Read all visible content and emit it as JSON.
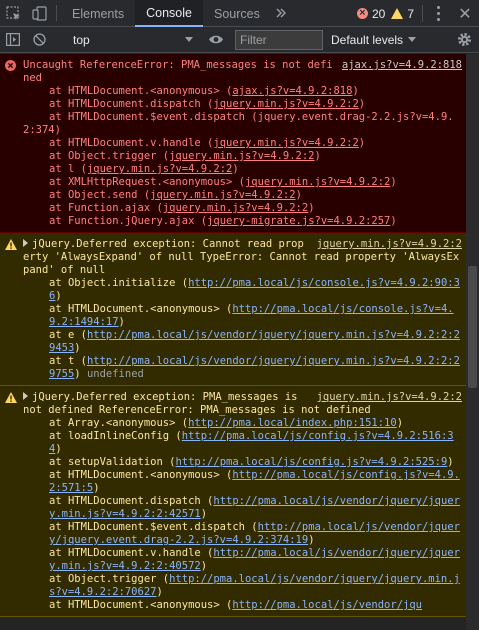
{
  "tabs": [
    {
      "label": "Elements"
    },
    {
      "label": "Console"
    },
    {
      "label": "Sources"
    }
  ],
  "counts": {
    "errors": "20",
    "warnings": "7"
  },
  "toolbar": {
    "context": "top",
    "filter_placeholder": "Filter",
    "levels": "Default levels"
  },
  "messages": [
    {
      "level": "error",
      "source": "ajax.js?v=4.9.2:818",
      "head": "Uncaught ReferenceError: PMA_messages is not defined",
      "stack": [
        {
          "pre": "at HTMLDocument.<anonymous> (",
          "link": "ajax.js?v=4.9.2:818",
          "post": ")"
        },
        {
          "pre": "at HTMLDocument.dispatch (",
          "link": "jquery.min.js?v=4.9.2:2",
          "post": ")"
        },
        {
          "pre": "at HTMLDocument.$event.dispatch (",
          "link": "jquery.event.drag-2.2.js?v=4.9.2:374",
          "post": ")"
        },
        {
          "pre": "at HTMLDocument.v.handle (",
          "link": "jquery.min.js?v=4.9.2:2",
          "post": ")"
        },
        {
          "pre": "at Object.trigger (",
          "link": "jquery.min.js?v=4.9.2:2",
          "post": ")"
        },
        {
          "pre": "at l (",
          "link": "jquery.min.js?v=4.9.2:2",
          "post": ")"
        },
        {
          "pre": "at XMLHttpRequest.<anonymous> (",
          "link": "jquery.min.js?v=4.9.2:2",
          "post": ")"
        },
        {
          "pre": "at Object.send (",
          "link": "jquery.min.js?v=4.9.2:2",
          "post": ")"
        },
        {
          "pre": "at Function.ajax (",
          "link": "jquery.min.js?v=4.9.2:2",
          "post": ")"
        },
        {
          "pre": "at Function.jQuery.ajax (",
          "link": "jquery-migrate.js?v=4.9.2:257",
          "post": ")"
        }
      ]
    },
    {
      "level": "warn",
      "source": "jquery.min.js?v=4.9.2:2",
      "head": "jQuery.Deferred exception: Cannot read property 'AlwaysExpand' of null TypeError: Cannot read property 'AlwaysExpand' of null",
      "stack": [
        {
          "pre": "at Object.initialize (",
          "link": "http://pma.local/js/console.js?v=4.9.2:90:36",
          "post": ")"
        },
        {
          "pre": "at HTMLDocument.<anonymous> (",
          "link": "http://pma.local/js/console.js?v=4.9.2:1494:17",
          "post": ")"
        },
        {
          "pre": "at e (",
          "link": "http://pma.local/js/vendor/jquery/jquery.min.js?v=4.9.2:2:29453",
          "post": ")"
        },
        {
          "pre": "at t (",
          "link": "http://pma.local/js/vendor/jquery/jquery.min.js?v=4.9.2:2:29755",
          "post": ")",
          "suffix": "undefined"
        }
      ]
    },
    {
      "level": "warn",
      "source": "jquery.min.js?v=4.9.2:2",
      "head": "jQuery.Deferred exception: PMA_messages is not defined ReferenceError: PMA_messages is not defined",
      "stack": [
        {
          "pre": "at Array.<anonymous> (",
          "link": "http://pma.local/index.php:151:10",
          "post": ")"
        },
        {
          "pre": "at loadInlineConfig (",
          "link": "http://pma.local/js/config.js?v=4.9.2:516:34",
          "post": ")"
        },
        {
          "pre": "at setupValidation (",
          "link": "http://pma.local/js/config.js?v=4.9.2:525:9",
          "post": ")"
        },
        {
          "pre": "at HTMLDocument.<anonymous> (",
          "link": "http://pma.local/js/config.js?v=4.9.2:571:5",
          "post": ")"
        },
        {
          "pre": "at HTMLDocument.dispatch (",
          "link": "http://pma.local/js/vendor/jquery/jquery.min.js?v=4.9.2:2:42571",
          "post": ")"
        },
        {
          "pre": "at HTMLDocument.$event.dispatch (",
          "link": "http://pma.local/js/vendor/jquery/jquery.event.drag-2.2.js?v=4.9.2:374:19",
          "post": ")"
        },
        {
          "pre": "at HTMLDocument.v.handle (",
          "link": "http://pma.local/js/vendor/jquery/jquery.min.js?v=4.9.2:2:40572",
          "post": ")"
        },
        {
          "pre": "at Object.trigger (",
          "link": "http://pma.local/js/vendor/jquery/jquery.min.js?v=4.9.2:2:70627",
          "post": ")"
        },
        {
          "pre": "at HTMLDocument.<anonymous> (",
          "link": "http://pma.local/js/vendor/jqu",
          "post": ""
        }
      ]
    }
  ]
}
